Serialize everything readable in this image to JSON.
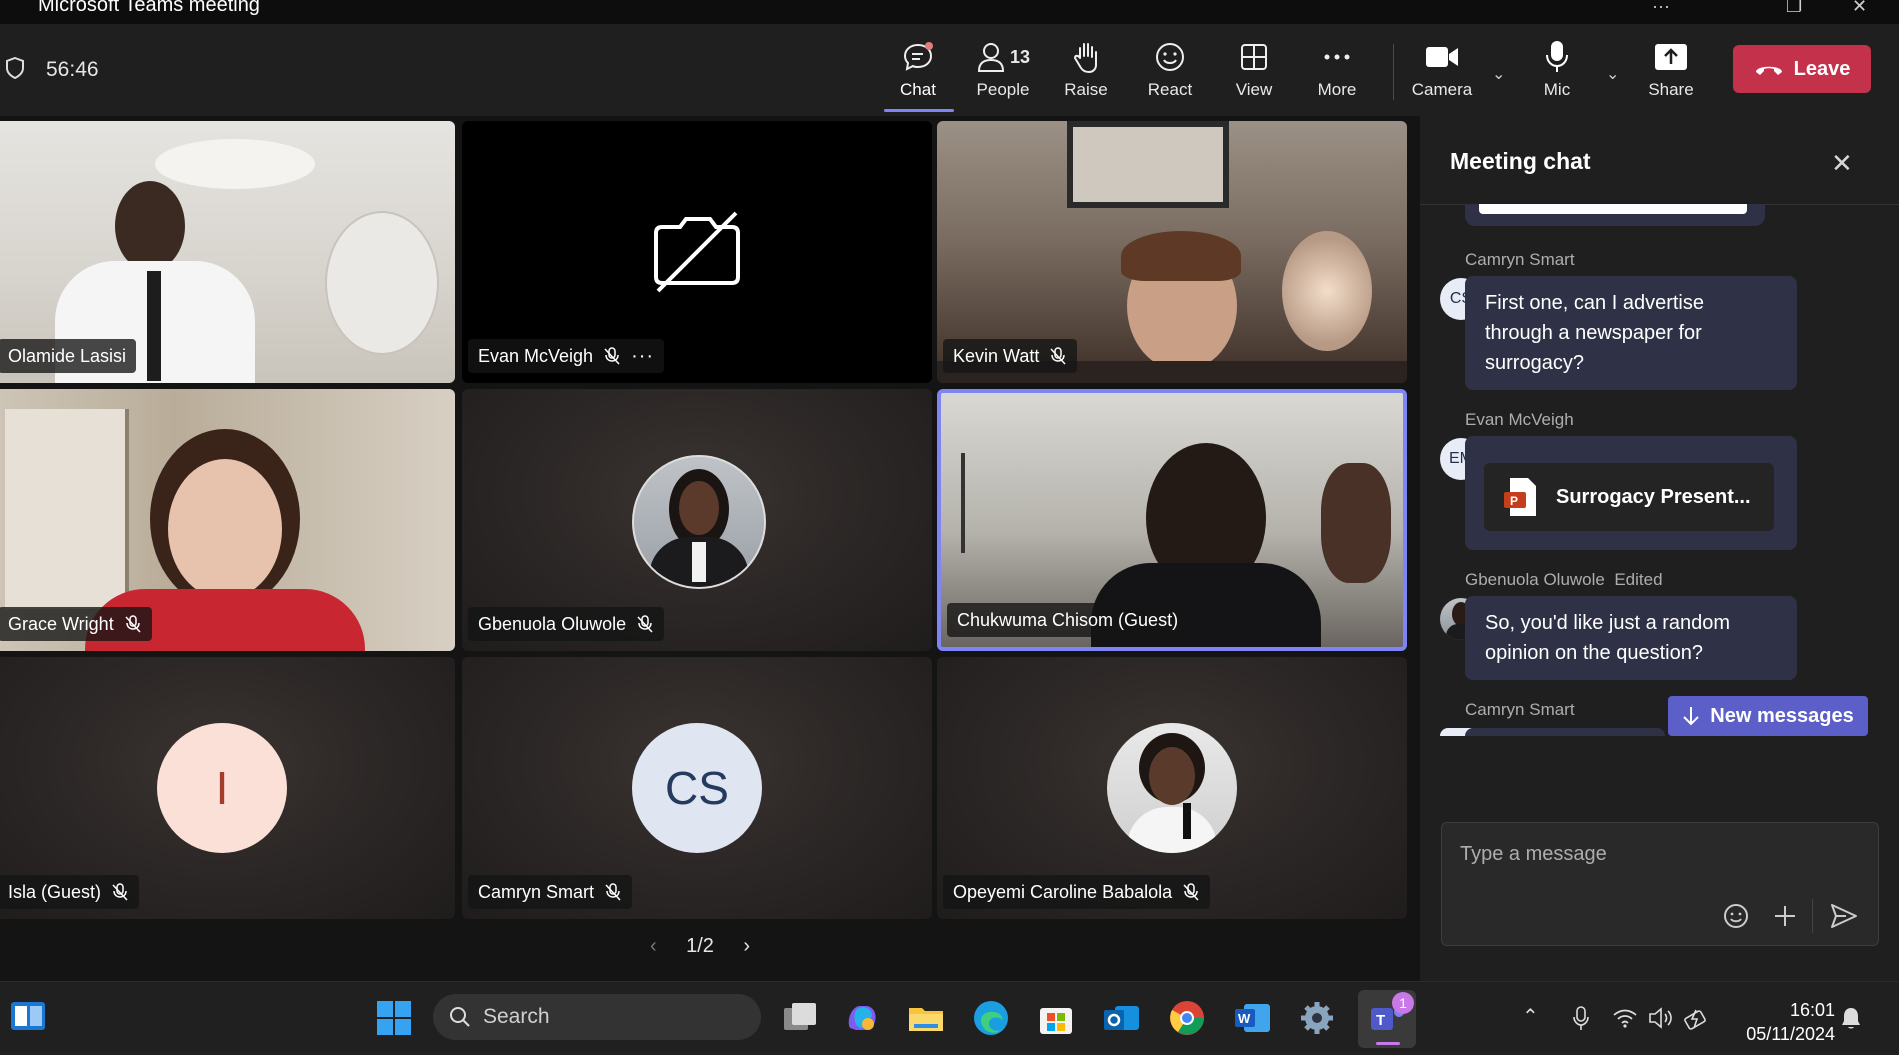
{
  "window": {
    "title": "Microsoft Teams meeting"
  },
  "header": {
    "timer": "56:46",
    "toolbar": [
      {
        "id": "chat",
        "label": "Chat",
        "icon": "chat-icon",
        "active": true
      },
      {
        "id": "people",
        "label": "People",
        "icon": "people-icon",
        "count": "13"
      },
      {
        "id": "raise",
        "label": "Raise",
        "icon": "raise-hand-icon"
      },
      {
        "id": "react",
        "label": "React",
        "icon": "smile-icon"
      },
      {
        "id": "view",
        "label": "View",
        "icon": "grid-view-icon"
      },
      {
        "id": "more",
        "label": "More",
        "icon": "more-icon"
      },
      {
        "id": "camera",
        "label": "Camera",
        "icon": "camera-icon"
      },
      {
        "id": "mic",
        "label": "Mic",
        "icon": "mic-icon"
      },
      {
        "id": "share",
        "label": "Share",
        "icon": "share-icon"
      }
    ],
    "leave_label": "Leave",
    "accent": "#c4314b"
  },
  "grid": {
    "participants": [
      {
        "name": "Olamide Lasisi",
        "muted": false,
        "kind": "video"
      },
      {
        "name": "Evan McVeigh",
        "muted": true,
        "kind": "camera-off"
      },
      {
        "name": "Kevin Watt",
        "muted": true,
        "kind": "video"
      },
      {
        "name": "Grace Wright",
        "muted": true,
        "kind": "video"
      },
      {
        "name": "Gbenuola Oluwole",
        "muted": true,
        "kind": "photo"
      },
      {
        "name": "Chukwuma Chisom (Guest)",
        "muted": false,
        "kind": "video",
        "speaking": true
      },
      {
        "name": "Isla (Guest)",
        "muted": true,
        "kind": "initials",
        "initials": "I"
      },
      {
        "name": "Camryn Smart",
        "muted": true,
        "kind": "initials",
        "initials": "CS"
      },
      {
        "name": "Opeyemi Caroline Babalola",
        "muted": true,
        "kind": "photo"
      }
    ],
    "page_indicator": "1/2"
  },
  "chat": {
    "title": "Meeting chat",
    "messages": [
      {
        "sender": "Camryn Smart",
        "initials": "CS",
        "text": "First one, can I advertise through a newspaper for surrogacy?"
      },
      {
        "sender": "Evan McVeigh",
        "initials": "EM",
        "attachment": "Surrogacy Present..."
      },
      {
        "sender": "Gbenuola Oluwole",
        "edited": "Edited",
        "text": "So, you'd like just a random opinion on the question?"
      },
      {
        "sender": "Camryn Smart"
      }
    ],
    "new_messages_label": "New messages",
    "composer_placeholder": "Type a message"
  },
  "taskbar": {
    "search_label": "Search",
    "time": "16:01",
    "date": "05/11/2024",
    "teams_badge": "1"
  }
}
